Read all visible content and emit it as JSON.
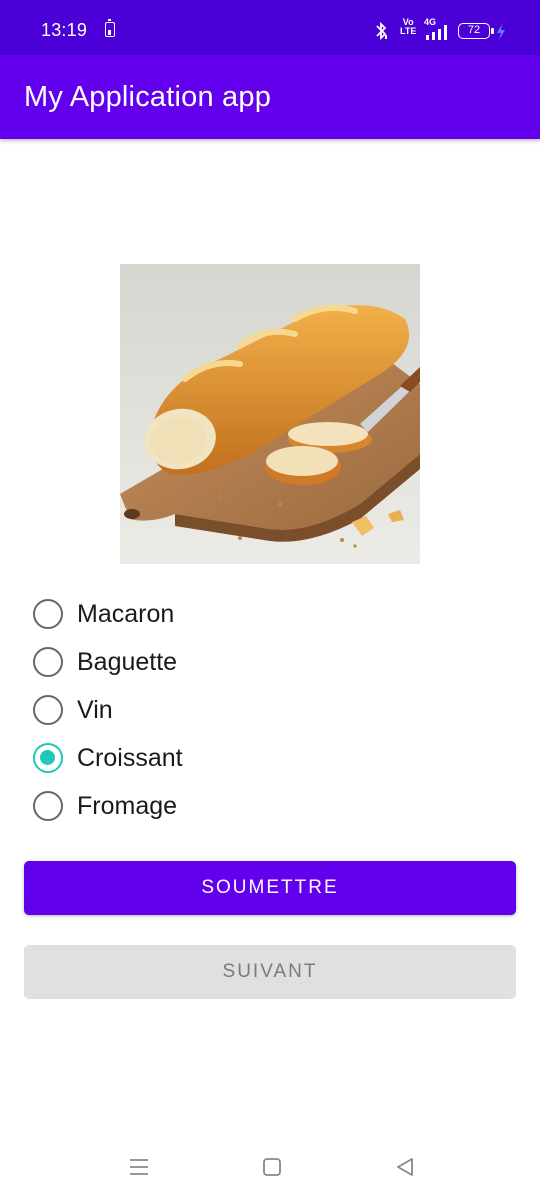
{
  "status_bar": {
    "time": "13:19",
    "network": "4G",
    "volte": "Vo LTE",
    "battery_level": "72"
  },
  "app_bar": {
    "title": "My Application app"
  },
  "quiz": {
    "image_icon": "baguette-on-cutting-board",
    "options": [
      {
        "label": "Macaron",
        "checked": false
      },
      {
        "label": "Baguette",
        "checked": false
      },
      {
        "label": "Vin",
        "checked": false
      },
      {
        "label": "Croissant",
        "checked": true
      },
      {
        "label": "Fromage",
        "checked": false
      }
    ],
    "submit_label": "SOUMETTRE",
    "next_label": "SUIVANT"
  },
  "colors": {
    "primary": "#6200ee",
    "status_bar": "#4a00d6",
    "radio_checked": "#1fc8b8",
    "disabled_button": "#e0e0e0"
  },
  "nav_bar": {
    "icons": [
      "menu-icon",
      "home-icon",
      "back-icon"
    ]
  }
}
